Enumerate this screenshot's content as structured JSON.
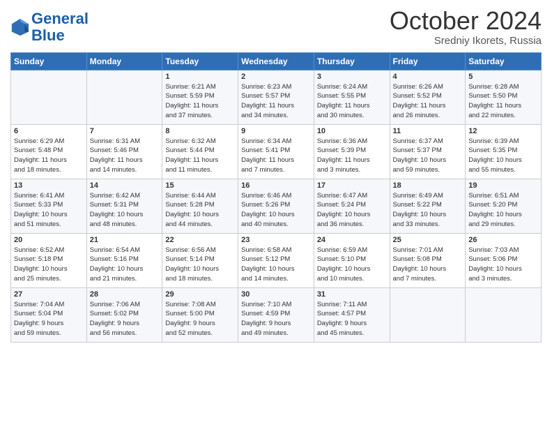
{
  "header": {
    "logo_line1": "General",
    "logo_line2": "Blue",
    "month": "October 2024",
    "location": "Sredniy Ikorets, Russia"
  },
  "days_of_week": [
    "Sunday",
    "Monday",
    "Tuesday",
    "Wednesday",
    "Thursday",
    "Friday",
    "Saturday"
  ],
  "weeks": [
    [
      {
        "day": "",
        "info": ""
      },
      {
        "day": "",
        "info": ""
      },
      {
        "day": "1",
        "info": "Sunrise: 6:21 AM\nSunset: 5:59 PM\nDaylight: 11 hours\nand 37 minutes."
      },
      {
        "day": "2",
        "info": "Sunrise: 6:23 AM\nSunset: 5:57 PM\nDaylight: 11 hours\nand 34 minutes."
      },
      {
        "day": "3",
        "info": "Sunrise: 6:24 AM\nSunset: 5:55 PM\nDaylight: 11 hours\nand 30 minutes."
      },
      {
        "day": "4",
        "info": "Sunrise: 6:26 AM\nSunset: 5:52 PM\nDaylight: 11 hours\nand 26 minutes."
      },
      {
        "day": "5",
        "info": "Sunrise: 6:28 AM\nSunset: 5:50 PM\nDaylight: 11 hours\nand 22 minutes."
      }
    ],
    [
      {
        "day": "6",
        "info": "Sunrise: 6:29 AM\nSunset: 5:48 PM\nDaylight: 11 hours\nand 18 minutes."
      },
      {
        "day": "7",
        "info": "Sunrise: 6:31 AM\nSunset: 5:46 PM\nDaylight: 11 hours\nand 14 minutes."
      },
      {
        "day": "8",
        "info": "Sunrise: 6:32 AM\nSunset: 5:44 PM\nDaylight: 11 hours\nand 11 minutes."
      },
      {
        "day": "9",
        "info": "Sunrise: 6:34 AM\nSunset: 5:41 PM\nDaylight: 11 hours\nand 7 minutes."
      },
      {
        "day": "10",
        "info": "Sunrise: 6:36 AM\nSunset: 5:39 PM\nDaylight: 11 hours\nand 3 minutes."
      },
      {
        "day": "11",
        "info": "Sunrise: 6:37 AM\nSunset: 5:37 PM\nDaylight: 10 hours\nand 59 minutes."
      },
      {
        "day": "12",
        "info": "Sunrise: 6:39 AM\nSunset: 5:35 PM\nDaylight: 10 hours\nand 55 minutes."
      }
    ],
    [
      {
        "day": "13",
        "info": "Sunrise: 6:41 AM\nSunset: 5:33 PM\nDaylight: 10 hours\nand 51 minutes."
      },
      {
        "day": "14",
        "info": "Sunrise: 6:42 AM\nSunset: 5:31 PM\nDaylight: 10 hours\nand 48 minutes."
      },
      {
        "day": "15",
        "info": "Sunrise: 6:44 AM\nSunset: 5:28 PM\nDaylight: 10 hours\nand 44 minutes."
      },
      {
        "day": "16",
        "info": "Sunrise: 6:46 AM\nSunset: 5:26 PM\nDaylight: 10 hours\nand 40 minutes."
      },
      {
        "day": "17",
        "info": "Sunrise: 6:47 AM\nSunset: 5:24 PM\nDaylight: 10 hours\nand 36 minutes."
      },
      {
        "day": "18",
        "info": "Sunrise: 6:49 AM\nSunset: 5:22 PM\nDaylight: 10 hours\nand 33 minutes."
      },
      {
        "day": "19",
        "info": "Sunrise: 6:51 AM\nSunset: 5:20 PM\nDaylight: 10 hours\nand 29 minutes."
      }
    ],
    [
      {
        "day": "20",
        "info": "Sunrise: 6:52 AM\nSunset: 5:18 PM\nDaylight: 10 hours\nand 25 minutes."
      },
      {
        "day": "21",
        "info": "Sunrise: 6:54 AM\nSunset: 5:16 PM\nDaylight: 10 hours\nand 21 minutes."
      },
      {
        "day": "22",
        "info": "Sunrise: 6:56 AM\nSunset: 5:14 PM\nDaylight: 10 hours\nand 18 minutes."
      },
      {
        "day": "23",
        "info": "Sunrise: 6:58 AM\nSunset: 5:12 PM\nDaylight: 10 hours\nand 14 minutes."
      },
      {
        "day": "24",
        "info": "Sunrise: 6:59 AM\nSunset: 5:10 PM\nDaylight: 10 hours\nand 10 minutes."
      },
      {
        "day": "25",
        "info": "Sunrise: 7:01 AM\nSunset: 5:08 PM\nDaylight: 10 hours\nand 7 minutes."
      },
      {
        "day": "26",
        "info": "Sunrise: 7:03 AM\nSunset: 5:06 PM\nDaylight: 10 hours\nand 3 minutes."
      }
    ],
    [
      {
        "day": "27",
        "info": "Sunrise: 7:04 AM\nSunset: 5:04 PM\nDaylight: 9 hours\nand 59 minutes."
      },
      {
        "day": "28",
        "info": "Sunrise: 7:06 AM\nSunset: 5:02 PM\nDaylight: 9 hours\nand 56 minutes."
      },
      {
        "day": "29",
        "info": "Sunrise: 7:08 AM\nSunset: 5:00 PM\nDaylight: 9 hours\nand 52 minutes."
      },
      {
        "day": "30",
        "info": "Sunrise: 7:10 AM\nSunset: 4:59 PM\nDaylight: 9 hours\nand 49 minutes."
      },
      {
        "day": "31",
        "info": "Sunrise: 7:11 AM\nSunset: 4:57 PM\nDaylight: 9 hours\nand 45 minutes."
      },
      {
        "day": "",
        "info": ""
      },
      {
        "day": "",
        "info": ""
      }
    ]
  ]
}
